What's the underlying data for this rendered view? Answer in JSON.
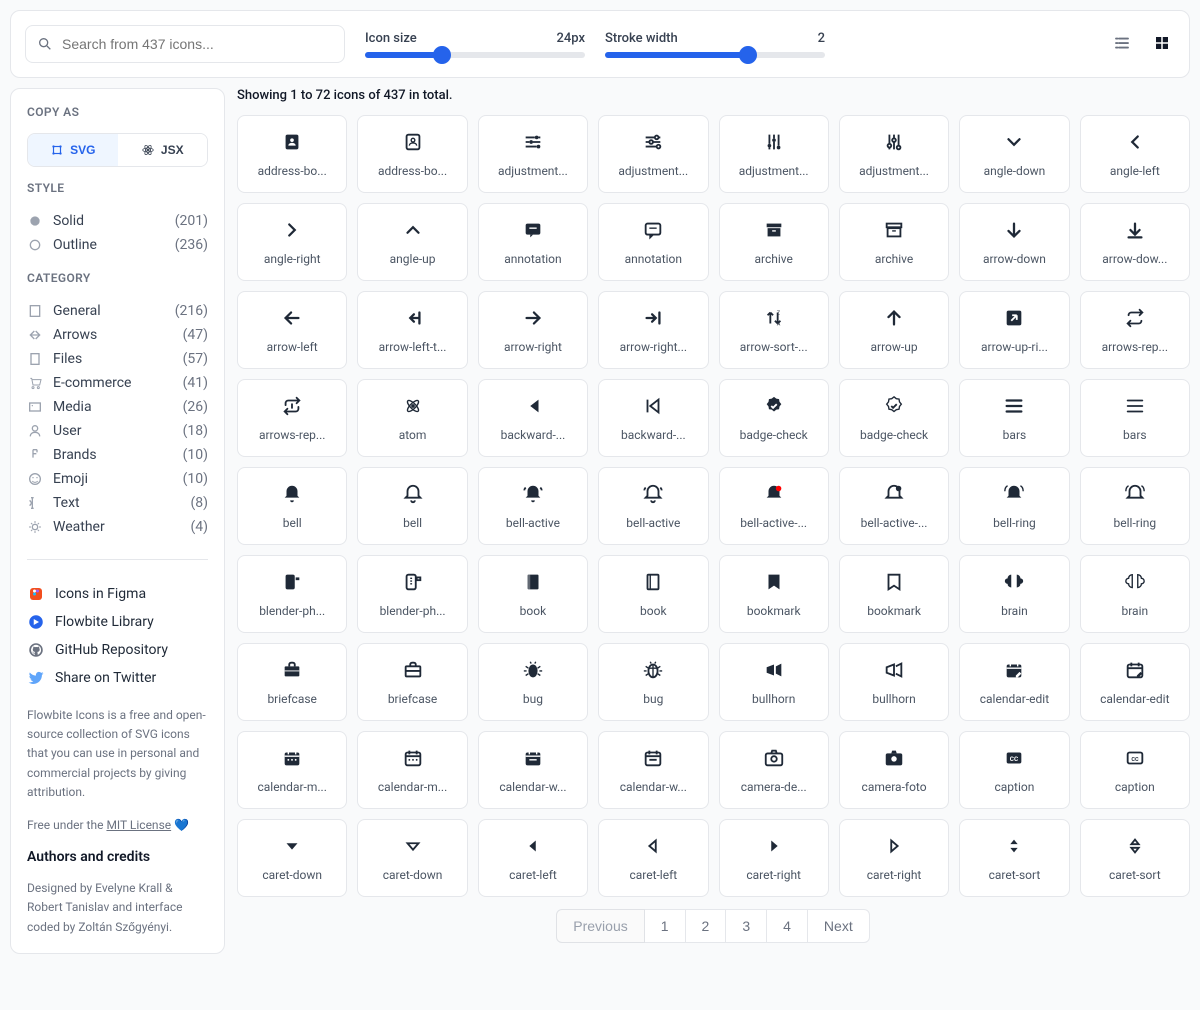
{
  "topbar": {
    "search_placeholder": "Search from 437 icons...",
    "icon_size_label": "Icon size",
    "icon_size_value": "24px",
    "icon_size_percent": 35,
    "stroke_label": "Stroke width",
    "stroke_value": "2",
    "stroke_percent": 65
  },
  "sidebar": {
    "copy_as": "COPY AS",
    "svg": "SVG",
    "jsx": "JSX",
    "style_title": "STYLE",
    "styles": [
      {
        "label": "Solid",
        "count": "(201)"
      },
      {
        "label": "Outline",
        "count": "(236)"
      }
    ],
    "category_title": "CATEGORY",
    "categories": [
      {
        "label": "General",
        "count": "(216)"
      },
      {
        "label": "Arrows",
        "count": "(47)"
      },
      {
        "label": "Files",
        "count": "(57)"
      },
      {
        "label": "E-commerce",
        "count": "(41)"
      },
      {
        "label": "Media",
        "count": "(26)"
      },
      {
        "label": "User",
        "count": "(18)"
      },
      {
        "label": "Brands",
        "count": "(10)"
      },
      {
        "label": "Emoji",
        "count": "(10)"
      },
      {
        "label": "Text",
        "count": "(8)"
      },
      {
        "label": "Weather",
        "count": "(4)"
      }
    ],
    "links": [
      {
        "label": "Icons in Figma",
        "color": "#F24E1E"
      },
      {
        "label": "Flowbite Library",
        "color": "#2563eb"
      },
      {
        "label": "GitHub Repository",
        "color": "#6b7280"
      },
      {
        "label": "Share on Twitter",
        "color": "#60a5fa"
      }
    ],
    "desc1": "Flowbite Icons is a free and open-source collection of SVG icons that you can use in personal and commercial projects by giving attribution.",
    "desc2_pre": "Free under the ",
    "desc2_link": "MIT License",
    "desc2_post": " 💙",
    "authors_title": "Authors and credits",
    "authors": "Designed by Evelyne Krall & Robert Tanislav and interface coded by Zoltán Szőgyényi."
  },
  "content": {
    "showing": "Showing 1 to 72 icons of 437 in total.",
    "icons": [
      {
        "label": "address-bo...",
        "svg": "<rect x='5' y='4' width='14' height='16' rx='2' fill='currentColor'/><circle cx='12' cy='10' r='2' fill='white'/><path d='M8 16c0-2 2-3 4-3s4 1 4 3' fill='white'/>"
      },
      {
        "label": "address-bo...",
        "svg": "<rect x='5' y='4' width='14' height='16' rx='2' fill='none' stroke='currentColor' stroke-width='2'/><circle cx='12' cy='10' r='2' fill='none' stroke='currentColor' stroke-width='1.5'/><path d='M8 16c0-2 2-3 4-3s4 1 4 3' stroke='currentColor' stroke-width='1.5' fill='none'/>"
      },
      {
        "label": "adjustment...",
        "svg": "<path d='M4 7h10M18 7h2M4 12h4M12 12h8M4 17h12M20 17h0' stroke='currentColor' stroke-width='2'/><circle cx='16' cy='7' r='2' fill='currentColor'/><circle cx='10' cy='12' r='2' fill='currentColor'/><circle cx='18' cy='17' r='2' fill='currentColor'/>"
      },
      {
        "label": "adjustment...",
        "svg": "<path d='M4 7h10M18 7h2M4 12h4M12 12h8M4 17h12' stroke='currentColor' stroke-width='2'/><circle cx='16' cy='7' r='2' stroke='currentColor' stroke-width='2' fill='none'/><circle cx='10' cy='12' r='2' stroke='currentColor' stroke-width='2' fill='none'/><circle cx='18' cy='17' r='2' stroke='currentColor' stroke-width='2' fill='none'/>"
      },
      {
        "label": "adjustment...",
        "svg": "<path d='M7 4v10M7 18v2M12 4v4M12 12v8M17 4v12M17 20v0' stroke='currentColor' stroke-width='2'/><circle cx='7' cy='16' r='2' fill='currentColor'/><circle cx='12' cy='10' r='2' fill='currentColor'/><circle cx='17' cy='18' r='2' fill='currentColor'/>"
      },
      {
        "label": "adjustment...",
        "svg": "<path d='M7 4v10M7 18v2M12 4v4M12 12v8M17 4v12' stroke='currentColor' stroke-width='2'/><circle cx='7' cy='16' r='2' stroke='currentColor' stroke-width='2' fill='none'/><circle cx='12' cy='10' r='2' stroke='currentColor' stroke-width='2' fill='none'/><circle cx='17' cy='18' r='2' stroke='currentColor' stroke-width='2' fill='none'/>"
      },
      {
        "label": "angle-down",
        "svg": "<path d='M6 9l6 6 6-6' stroke='currentColor' stroke-width='2.5' fill='none' stroke-linecap='round'/>"
      },
      {
        "label": "angle-left",
        "svg": "<path d='M15 6l-6 6 6 6' stroke='currentColor' stroke-width='2.5' fill='none' stroke-linecap='round'/>"
      },
      {
        "label": "angle-right",
        "svg": "<path d='M9 6l6 6-6 6' stroke='currentColor' stroke-width='2.5' fill='none' stroke-linecap='round'/>"
      },
      {
        "label": "angle-up",
        "svg": "<path d='M6 15l6-6 6 6' stroke='currentColor' stroke-width='2.5' fill='none' stroke-linecap='round'/>"
      },
      {
        "label": "annotation",
        "svg": "<rect x='4' y='5' width='16' height='12' rx='2' fill='currentColor'/><path d='M12 17l-3 3v-3' fill='currentColor'/><path d='M8 10h8' stroke='white' stroke-width='1.5'/>"
      },
      {
        "label": "annotation",
        "svg": "<rect x='4' y='5' width='16' height='12' rx='2' stroke='currentColor' stroke-width='2' fill='none'/><path d='M12 17l-3 3v-3' stroke='currentColor' stroke-width='2' fill='none'/><path d='M8 10h8' stroke='currentColor' stroke-width='1.5'/>"
      },
      {
        "label": "archive",
        "svg": "<rect x='4' y='5' width='16' height='4' fill='currentColor'/><rect x='5' y='10' width='14' height='9' fill='currentColor'/><path d='M10 13h4' stroke='white' stroke-width='1.5'/>"
      },
      {
        "label": "archive",
        "svg": "<rect x='4' y='5' width='16' height='4' stroke='currentColor' stroke-width='2' fill='none'/><rect x='5' y='10' width='14' height='9' stroke='currentColor' stroke-width='2' fill='none'/><path d='M10 13h4' stroke='currentColor' stroke-width='1.5'/>"
      },
      {
        "label": "arrow-down",
        "svg": "<path d='M12 5v14M6 13l6 6 6-6' stroke='currentColor' stroke-width='2.5' fill='none' stroke-linecap='round'/>"
      },
      {
        "label": "arrow-dow...",
        "svg": "<path d='M12 5v11M7 12l5 5 5-5M5 20h14' stroke='currentColor' stroke-width='2.5' fill='none' stroke-linecap='round'/>"
      },
      {
        "label": "arrow-left",
        "svg": "<path d='M19 12H5M11 6l-6 6 6 6' stroke='currentColor' stroke-width='2.5' fill='none' stroke-linecap='round'/>"
      },
      {
        "label": "arrow-left-t...",
        "svg": "<path d='M19 12H9M13 8l-4 4 4 4M19 6v12' stroke='currentColor' stroke-width='2.5' fill='none' stroke-linecap='round'/>"
      },
      {
        "label": "arrow-right",
        "svg": "<path d='M5 12h14M13 6l6 6-6 6' stroke='currentColor' stroke-width='2.5' fill='none' stroke-linecap='round'/>"
      },
      {
        "label": "arrow-right...",
        "svg": "<path d='M5 12h10M11 8l4 4-4 4M19 6v12' stroke='currentColor' stroke-width='2.5' fill='none' stroke-linecap='round'/>"
      },
      {
        "label": "arrow-sort-...",
        "svg": "<path d='M8 6v12M8 6l-3 3M8 6l3 3M16 18V6M16 18l3-3M16 18l-3-3' stroke='currentColor' stroke-width='2' fill='none'/><text x='15' y='8' font-size='6' fill='currentColor'>Z</text><text x='15' y='20' font-size='6' fill='currentColor'>A</text>"
      },
      {
        "label": "arrow-up",
        "svg": "<path d='M12 19V5M6 11l6-6 6 6' stroke='currentColor' stroke-width='2.5' fill='none' stroke-linecap='round'/>"
      },
      {
        "label": "arrow-up-ri...",
        "svg": "<rect x='4' y='4' width='16' height='16' rx='2' fill='currentColor'/><path d='M9 15l6-6M15 9h-5M15 9v5' stroke='white' stroke-width='2' fill='none'/>"
      },
      {
        "label": "arrows-rep...",
        "svg": "<path d='M17 3l3 3-3 3M20 6H8a3 3 0 00-3 3M7 21l-3-3 3-3M4 18h12a3 3 0 003-3' stroke='currentColor' stroke-width='2' fill='none' stroke-linecap='round'/>"
      },
      {
        "label": "arrows-rep...",
        "svg": "<path d='M17 3l3 3-3 3M20 6H8a3 3 0 00-3 3v2M7 21l-3-3 3-3M4 18h12a3 3 0 003-3v-2M12 10v4' stroke='currentColor' stroke-width='2' fill='none' stroke-linecap='round'/>"
      },
      {
        "label": "atom",
        "svg": "<circle cx='12' cy='12' r='2' fill='currentColor'/><ellipse cx='12' cy='12' rx='8' ry='3' stroke='currentColor' stroke-width='1.5' fill='none' transform='rotate(45 12 12)'/><ellipse cx='12' cy='12' rx='8' ry='3' stroke='currentColor' stroke-width='1.5' fill='none' transform='rotate(-45 12 12)'/>"
      },
      {
        "label": "backward-...",
        "svg": "<path d='M6 5v14M18 5l-9 7 9 7V5z' fill='currentColor'/>"
      },
      {
        "label": "backward-...",
        "svg": "<path d='M6 5v14M18 5l-9 7 9 7V5z' stroke='currentColor' stroke-width='2' fill='none'/>"
      },
      {
        "label": "badge-check",
        "svg": "<path d='M12 2l2.5 2 3 .5.5 3 2 2.5-2 2.5-.5 3-3 .5L12 18l-2.5-2-3-.5-.5-3L4 10l2-2.5.5-3 3-.5L12 2z' fill='currentColor'/><path d='M9 12l2 2 4-4' stroke='white' stroke-width='2' fill='none'/>"
      },
      {
        "label": "badge-check",
        "svg": "<path d='M12 2l2.5 2 3 .5.5 3 2 2.5-2 2.5-.5 3-3 .5L12 18l-2.5-2-3-.5-.5-3L4 10l2-2.5.5-3 3-.5L12 2z' stroke='currentColor' stroke-width='1.5' fill='none'/><path d='M9 12l2 2 4-4' stroke='currentColor' stroke-width='2' fill='none'/>"
      },
      {
        "label": "bars",
        "svg": "<path d='M4 6h16M4 12h16M4 18h16' stroke='currentColor' stroke-width='2.5' stroke-linecap='round'/>"
      },
      {
        "label": "bars",
        "svg": "<path d='M4 6h16M4 12h16M4 18h16' stroke='currentColor' stroke-width='2' stroke-linecap='round'/>"
      },
      {
        "label": "bell",
        "svg": "<path d='M12 3a6 6 0 016 6v5l2 2H4l2-2V9a6 6 0 016-6z' fill='currentColor'/><path d='M10 19a2 2 0 004 0' fill='currentColor'/>"
      },
      {
        "label": "bell",
        "svg": "<path d='M12 3a6 6 0 016 6v5l2 2H4l2-2V9a6 6 0 016-6zM10 19a2 2 0 004 0' stroke='currentColor' stroke-width='2' fill='none'/>"
      },
      {
        "label": "bell-active",
        "svg": "<path d='M12 3a6 6 0 016 6v5l2 2H4l2-2V9a6 6 0 016-6z' fill='currentColor'/><path d='M10 19a2 2 0 004 0' fill='currentColor'/><path d='M4 5c-1 1-1.5 2-1.5 3M20 5c1 1 1.5 2 1.5 3' stroke='currentColor' stroke-width='2' fill='none'/>"
      },
      {
        "label": "bell-active",
        "svg": "<path d='M12 3a6 6 0 016 6v5l2 2H4l2-2V9a6 6 0 016-6zM10 19a2 2 0 004 0' stroke='currentColor' stroke-width='2' fill='none'/><path d='M4 5c-1 1-1.5 2-1.5 3M20 5c1 1 1.5 2 1.5 3' stroke='currentColor' stroke-width='2' fill='none'/>"
      },
      {
        "label": "bell-active-...",
        "svg": "<path d='M12 3a6 6 0 016 6v5l2 2H4l2-2V9a6 6 0 016-6z' fill='currentColor'/><circle cx='17' cy='6' r='3' fill='red'/>"
      },
      {
        "label": "bell-active-...",
        "svg": "<path d='M12 3a6 6 0 016 6v5l2 2H4l2-2V9a6 6 0 016-6z' stroke='currentColor' stroke-width='2' fill='none'/><circle cx='17' cy='6' r='3' fill='currentColor'/>"
      },
      {
        "label": "bell-ring",
        "svg": "<path d='M12 3a6 6 0 016 6v5l2 2H4l2-2V9a6 6 0 016-6z' fill='currentColor'/><path d='M2 9c0-3 1-5 3-6M22 9c0-3-1-5-3-6' stroke='currentColor' stroke-width='1.5' fill='none'/>"
      },
      {
        "label": "bell-ring",
        "svg": "<path d='M12 3a6 6 0 016 6v5l2 2H4l2-2V9a6 6 0 016-6z' stroke='currentColor' stroke-width='2' fill='none'/><path d='M2 9c0-3 1-5 3-6M22 9c0-3-1-5-3-6' stroke='currentColor' stroke-width='1.5' fill='none'/>"
      },
      {
        "label": "blender-ph...",
        "svg": "<rect x='5' y='4' width='10' height='16' rx='2' fill='currentColor'/><rect x='16' y='7' width='4' height='3' fill='currentColor'/>"
      },
      {
        "label": "blender-ph...",
        "svg": "<rect x='5' y='4' width='10' height='16' rx='2' stroke='currentColor' stroke-width='2' fill='none'/><rect x='16' y='7' width='4' height='3' stroke='currentColor' stroke-width='2' fill='none'/><path d='M9 8h2M9 11h2M9 14h2' stroke='currentColor' stroke-width='1.5'/>"
      },
      {
        "label": "book",
        "svg": "<rect x='6' y='4' width='12' height='16' rx='1' fill='currentColor'/><rect x='6' y='4' width='3' height='16' fill='white' opacity='.3'/>"
      },
      {
        "label": "book",
        "svg": "<rect x='6' y='4' width='12' height='16' rx='1' stroke='currentColor' stroke-width='2' fill='none'/><path d='M9 4v16' stroke='currentColor' stroke-width='1.5'/>"
      },
      {
        "label": "bookmark",
        "svg": "<path d='M6 4h12v16l-6-4-6 4V4z' fill='currentColor'/>"
      },
      {
        "label": "bookmark",
        "svg": "<path d='M6 4h12v16l-6-4-6 4V4z' stroke='currentColor' stroke-width='2' fill='none'/>"
      },
      {
        "label": "brain",
        "svg": "<path d='M9 4a4 4 0 00-4 4 3 3 0 000 6 4 4 0 004 4V4zM15 4a4 4 0 014 4 3 3 0 010 6 4 4 0 01-4 4V4z' fill='currentColor'/>"
      },
      {
        "label": "brain",
        "svg": "<path d='M9 4a4 4 0 00-4 4 3 3 0 000 6 4 4 0 004 4V4zM15 4a4 4 0 014 4 3 3 0 010 6 4 4 0 01-4 4V4z' stroke='currentColor' stroke-width='1.5' fill='none'/>"
      },
      {
        "label": "briefcase",
        "svg": "<rect x='4' y='8' width='16' height='11' rx='1' fill='currentColor'/><path d='M9 8V6a2 2 0 012-2h2a2 2 0 012 2v2' stroke='currentColor' stroke-width='2' fill='none'/><path d='M4 13h16' stroke='white' stroke-width='1'/>"
      },
      {
        "label": "briefcase",
        "svg": "<rect x='4' y='8' width='16' height='11' rx='1' stroke='currentColor' stroke-width='2' fill='none'/><path d='M9 8V6a2 2 0 012-2h2a2 2 0 012 2v2M4 13h16' stroke='currentColor' stroke-width='2' fill='none'/>"
      },
      {
        "label": "bug",
        "svg": "<ellipse cx='12' cy='13' rx='5' ry='7' fill='currentColor'/><path d='M7 10l-3-2M17 10l3-2M7 16l-3 2M17 16l3 2M5 13H2M19 13h3M10 5l-1-2M14 5l1-2' stroke='currentColor' stroke-width='1.5'/>"
      },
      {
        "label": "bug",
        "svg": "<ellipse cx='12' cy='13' rx='5' ry='7' stroke='currentColor' stroke-width='2' fill='none'/><path d='M7 10l-3-2M17 10l3-2M7 16l-3 2M17 16l3 2M5 13H2M19 13h3M10 5l-1-2M14 5l1-2M12 6v14M8 10h8' stroke='currentColor' stroke-width='1.5'/>"
      },
      {
        "label": "bullhorn",
        "svg": "<path d='M4 9v6l8 3V6L4 9zM14 8l6-3v14l-6-3' fill='currentColor'/>"
      },
      {
        "label": "bullhorn",
        "svg": "<path d='M4 9v6l8 3V6L4 9zM14 8l6-3v14l-6-3' stroke='currentColor' stroke-width='2' fill='none'/>"
      },
      {
        "label": "calendar-edit",
        "svg": "<rect x='4' y='6' width='16' height='14' rx='2' fill='currentColor'/><path d='M4 10h16M8 4v4M16 4v4' stroke='white' stroke-width='1.5'/><path d='M14 18l4-4 2 2-4 4h-2v-2z' fill='white'/>"
      },
      {
        "label": "calendar-edit",
        "svg": "<rect x='4' y='6' width='16' height='14' rx='2' stroke='currentColor' stroke-width='2' fill='none'/><path d='M4 10h16M8 4v4M16 4v4' stroke='currentColor' stroke-width='2'/><path d='M14 18l4-4 2 2-4 4h-2v-2z' fill='currentColor'/>"
      },
      {
        "label": "calendar-m...",
        "svg": "<rect x='4' y='6' width='16' height='14' rx='2' fill='currentColor'/><path d='M4 10h16M8 4v4M16 4v4' stroke='white' stroke-width='1.5'/><circle cx='8' cy='14' r='1' fill='white'/><circle cx='12' cy='14' r='1' fill='white'/><circle cx='16' cy='14' r='1' fill='white'/>"
      },
      {
        "label": "calendar-m...",
        "svg": "<rect x='4' y='6' width='16' height='14' rx='2' stroke='currentColor' stroke-width='2' fill='none'/><path d='M4 10h16M8 4v4M16 4v4' stroke='currentColor' stroke-width='2'/><circle cx='8' cy='14' r='1' fill='currentColor'/><circle cx='12' cy='14' r='1' fill='currentColor'/><circle cx='16' cy='14' r='1' fill='currentColor'/>"
      },
      {
        "label": "calendar-w...",
        "svg": "<rect x='4' y='6' width='16' height='14' rx='2' fill='currentColor'/><path d='M4 10h16M8 4v4M16 4v4M8 14h8' stroke='white' stroke-width='1.5'/>"
      },
      {
        "label": "calendar-w...",
        "svg": "<rect x='4' y='6' width='16' height='14' rx='2' stroke='currentColor' stroke-width='2' fill='none'/><path d='M4 10h16M8 4v4M16 4v4M8 14h8' stroke='currentColor' stroke-width='2'/>"
      },
      {
        "label": "camera-de...",
        "svg": "<rect x='3' y='7' width='18' height='13' rx='2' stroke='currentColor' stroke-width='2' fill='none'/><circle cx='12' cy='13' r='3' stroke='currentColor' stroke-width='2' fill='none'/><path d='M9 7l1-3h4l1 3' stroke='currentColor' stroke-width='2' fill='none'/>"
      },
      {
        "label": "camera-foto",
        "svg": "<rect x='3' y='7' width='18' height='13' rx='2' fill='currentColor'/><circle cx='12' cy='13' r='3' fill='white'/><path d='M9 7l1-3h4l1 3' fill='currentColor'/>"
      },
      {
        "label": "caption",
        "svg": "<rect x='4' y='6' width='16' height='12' rx='2' fill='currentColor'/><text x='12' y='15' font-size='7' fill='white' text-anchor='middle' font-weight='bold'>CC</text>"
      },
      {
        "label": "caption",
        "svg": "<rect x='4' y='6' width='16' height='12' rx='2' stroke='currentColor' stroke-width='2' fill='none'/><text x='12' y='15' font-size='6' fill='currentColor' text-anchor='middle' font-weight='bold'>CC</text>"
      },
      {
        "label": "caret-down",
        "svg": "<path d='M6 9h12l-6 7-6-7z' fill='currentColor'/>"
      },
      {
        "label": "caret-down",
        "svg": "<path d='M6 9h12l-6 7-6-7z' stroke='currentColor' stroke-width='2' fill='none'/>"
      },
      {
        "label": "caret-left",
        "svg": "<path d='M15 6v12l-7-6 7-6z' fill='currentColor'/>"
      },
      {
        "label": "caret-left",
        "svg": "<path d='M15 6v12l-7-6 7-6z' stroke='currentColor' stroke-width='2' fill='none'/>"
      },
      {
        "label": "caret-right",
        "svg": "<path d='M9 6v12l7-6-7-6z' fill='currentColor'/>"
      },
      {
        "label": "caret-right",
        "svg": "<path d='M9 6v12l7-6-7-6z' stroke='currentColor' stroke-width='2' fill='none'/>"
      },
      {
        "label": "caret-sort",
        "svg": "<path d='M8 10l4-5 4 5H8zM8 14l4 5 4-5H8z' fill='currentColor'/>"
      },
      {
        "label": "caret-sort",
        "svg": "<path d='M8 10l4-5 4 5H8zM8 14l4 5 4-5H8z' stroke='currentColor' stroke-width='2' fill='none'/>"
      }
    ],
    "pagination": {
      "previous": "Previous",
      "pages": [
        "1",
        "2",
        "3",
        "4"
      ],
      "next": "Next"
    }
  }
}
